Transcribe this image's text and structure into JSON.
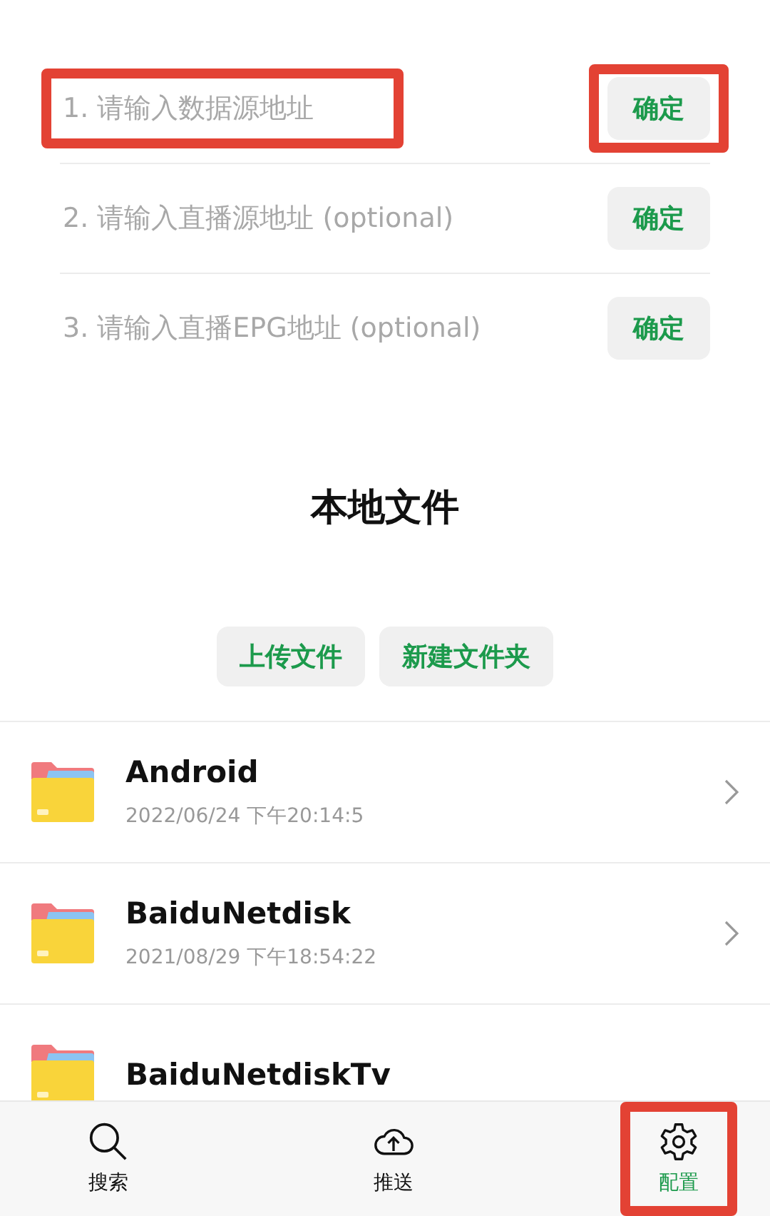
{
  "sources": [
    {
      "placeholder": "1. 请输入数据源地址",
      "button": "确定",
      "field_highlighted": true,
      "button_highlighted": true
    },
    {
      "placeholder": "2. 请输入直播源地址 (optional)",
      "button": "确定",
      "field_highlighted": false,
      "button_highlighted": false
    },
    {
      "placeholder": "3. 请输入直播EPG地址 (optional)",
      "button": "确定",
      "field_highlighted": false,
      "button_highlighted": false
    }
  ],
  "local": {
    "title": "本地文件",
    "actions": [
      "上传文件",
      "新建文件夹"
    ]
  },
  "files": [
    {
      "name": "Android",
      "date": "2022/06/24 下午20:14:5"
    },
    {
      "name": "BaiduNetdisk",
      "date": "2021/08/29 下午18:54:22"
    },
    {
      "name": "BaiduNetdiskTv"
    }
  ],
  "tabs": [
    {
      "kind": "search",
      "label": "搜索",
      "selected": false,
      "highlighted": false
    },
    {
      "kind": "upload",
      "label": "推送",
      "selected": false,
      "highlighted": false
    },
    {
      "kind": "settings",
      "label": "配置",
      "selected": true,
      "highlighted": true
    }
  ]
}
